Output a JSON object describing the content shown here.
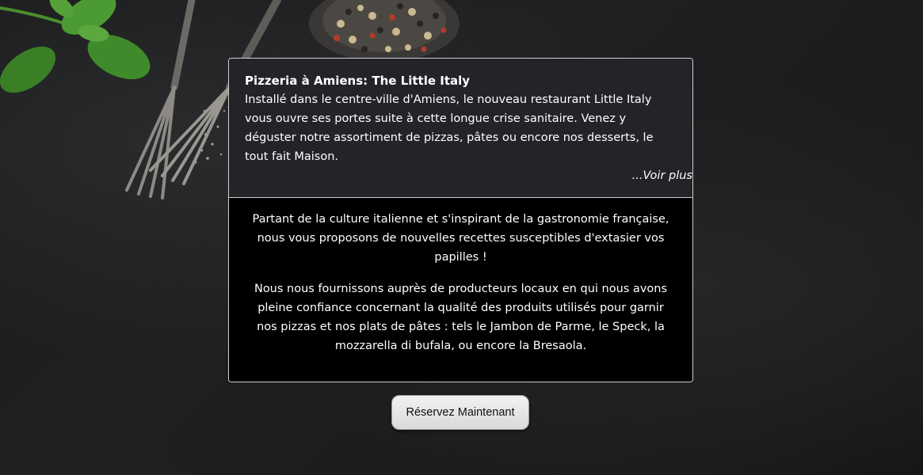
{
  "card": {
    "title": "Pizzeria à Amiens: The Little Italy",
    "intro": "Installé dans le centre-ville d'Amiens, le nouveau restaurant Little Italy vous ouvre ses portes suite à cette longue crise sanitaire. Venez y déguster notre assortiment de pizzas, pâtes ou encore nos desserts, le tout fait Maison.",
    "see_more": "...Voir plus",
    "paragraph_1": "Partant de la culture italienne et s'inspirant de la gastronomie française, nous vous proposons de nouvelles recettes susceptibles d'extasier vos papilles !",
    "paragraph_2": "Nous nous fournissons auprès de producteurs locaux en qui nous avons pleine confiance concernant la qualité des produits utilisés pour garnir nos pizzas et nos plats de pâtes : tels le Jambon de Parme, le Speck, la mozzarella di bufala, ou encore la Bresaola."
  },
  "cta": {
    "reserve_label": "Réservez Maintenant"
  },
  "colors": {
    "background": "#1e1f20",
    "card_top": "#222427",
    "card_bottom": "#000000",
    "text": "#ffffff",
    "basil": "#3f8a2a"
  },
  "decor": {
    "items": [
      "basil-leaves-icon",
      "forks-icon",
      "peppercorn-bowl-icon",
      "salt-icon"
    ]
  }
}
